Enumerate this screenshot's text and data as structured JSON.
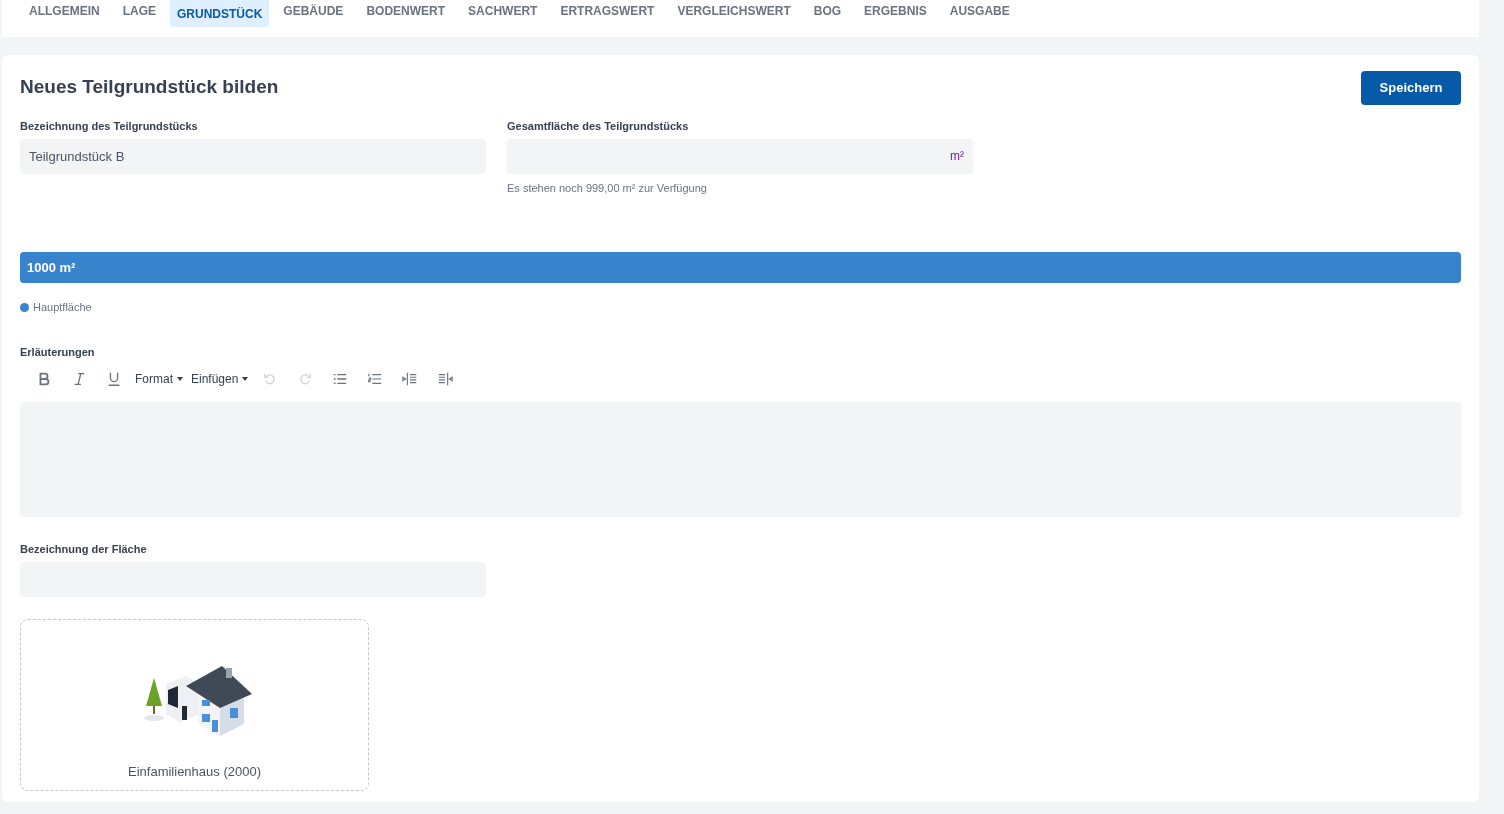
{
  "tabs": [
    {
      "label": "ALLGEMEIN",
      "selected": false
    },
    {
      "label": "LAGE",
      "selected": false
    },
    {
      "label": "GRUNDSTÜCK",
      "selected": true
    },
    {
      "label": "GEBÄUDE",
      "selected": false
    },
    {
      "label": "BODENWERT",
      "selected": false
    },
    {
      "label": "SACHWERT",
      "selected": false
    },
    {
      "label": "ERTRAGSWERT",
      "selected": false
    },
    {
      "label": "VERGLEICHSWERT",
      "selected": false
    },
    {
      "label": "BOG",
      "selected": false
    },
    {
      "label": "ERGEBNIS",
      "selected": false
    },
    {
      "label": "AUSGABE",
      "selected": false
    }
  ],
  "title": "Neues Teilgrundstück bilden",
  "save_button": "Speichern",
  "name_field": {
    "label": "Bezeichnung des Teilgrundstücks",
    "value": "Teilgrundstück B"
  },
  "area_field": {
    "label": "Gesamtfläche des Teilgrundstücks",
    "unit": "m²",
    "hint": "Es stehen noch 999,00 m² zur Verfügung"
  },
  "area_bar": {
    "label": "1000 m²",
    "level": 1.0,
    "color": "#3783cc"
  },
  "legend": [
    {
      "label": "Hauptfläche",
      "color": "#3783cc"
    }
  ],
  "editor": {
    "label": "Erläuterungen",
    "toolbar": [
      {
        "kind": "bold",
        "disabled": false
      },
      {
        "kind": "italic",
        "disabled": false
      },
      {
        "kind": "underline",
        "disabled": false
      },
      {
        "kind": "dropdown",
        "label": "Format",
        "disabled": false
      },
      {
        "kind": "dropdown",
        "label": "Einfügen",
        "disabled": false
      },
      {
        "kind": "undo",
        "disabled": true
      },
      {
        "kind": "redo",
        "disabled": true
      },
      {
        "kind": "bullets",
        "disabled": false
      },
      {
        "kind": "numbers",
        "disabled": false
      },
      {
        "kind": "outdent",
        "disabled": false
      },
      {
        "kind": "indent",
        "disabled": false
      }
    ]
  },
  "surface_field": {
    "label": "Bezeichnung der Fläche"
  },
  "building_card": {
    "label": "Einfamilienhaus (2000)"
  }
}
